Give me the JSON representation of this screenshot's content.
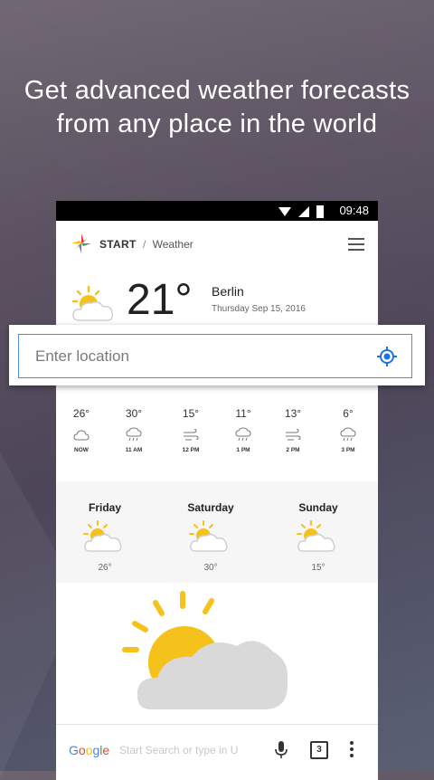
{
  "headline": {
    "line1": "Get advanced weather forecasts",
    "line2": "from any place in the world"
  },
  "status_bar": {
    "time": "09:48"
  },
  "app_bar": {
    "breadcrumb_root": "START",
    "breadcrumb_sep": "/",
    "breadcrumb_page": "Weather"
  },
  "current": {
    "temperature": "21°",
    "city": "Berlin",
    "date": "Thursday Sep 15, 2016",
    "icon": "partly-cloudy-icon"
  },
  "location_input": {
    "placeholder": "Enter location",
    "value": ""
  },
  "hourly": [
    {
      "temp": "26°",
      "label": "NOW",
      "icon": "cloud-icon"
    },
    {
      "temp": "30°",
      "label": "11 AM",
      "icon": "rain-icon"
    },
    {
      "temp": "15°",
      "label": "12 PM",
      "icon": "wind-icon"
    },
    {
      "temp": "11°",
      "label": "1 PM",
      "icon": "rain-icon"
    },
    {
      "temp": "13°",
      "label": "2 PM",
      "icon": "wind-icon"
    },
    {
      "temp": "6°",
      "label": "3 PM",
      "icon": "rain-icon"
    }
  ],
  "daily": [
    {
      "day": "Friday",
      "temp": "26°",
      "icon": "partly-cloudy-icon"
    },
    {
      "day": "Saturday",
      "temp": "30°",
      "icon": "partly-cloudy-icon"
    },
    {
      "day": "Sunday",
      "temp": "15°",
      "icon": "partly-cloudy-icon"
    }
  ],
  "bottom_bar": {
    "google_logo": "Google",
    "search_placeholder": "Start Search or type in U",
    "tab_count": "3"
  },
  "colors": {
    "accent": "#4d8fd6",
    "sun": "#f5c21b",
    "cloud": "#d9d9d9"
  }
}
